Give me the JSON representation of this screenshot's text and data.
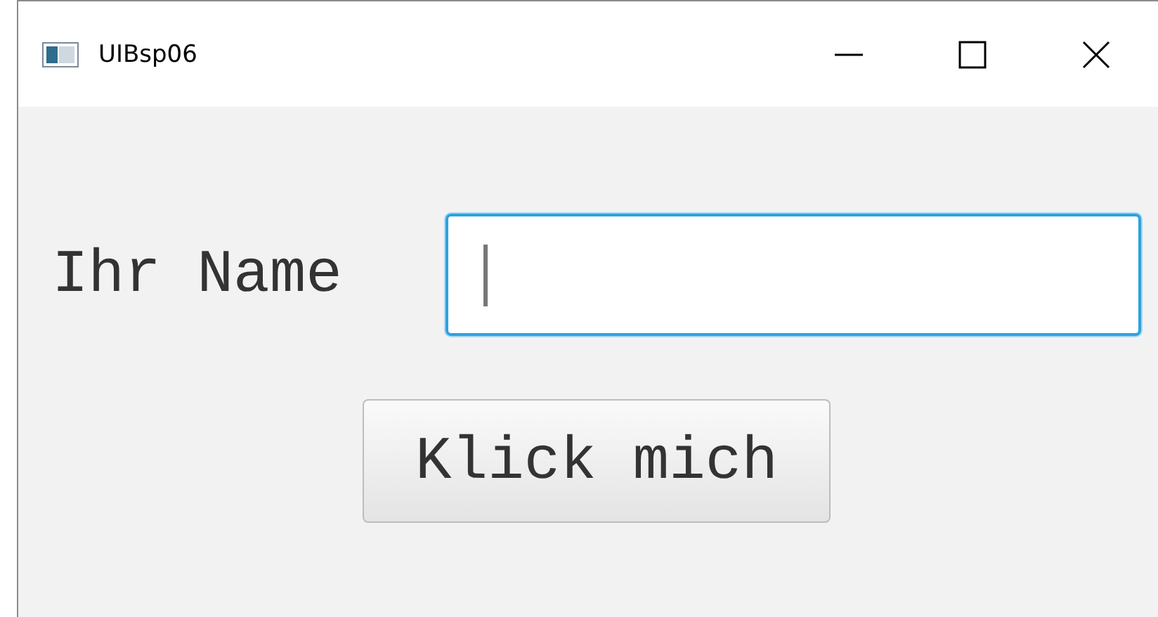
{
  "window": {
    "title": "UIBsp06"
  },
  "form": {
    "label": "Ihr Name",
    "name_field": {
      "focused": true
    },
    "button": "Klick mich"
  }
}
